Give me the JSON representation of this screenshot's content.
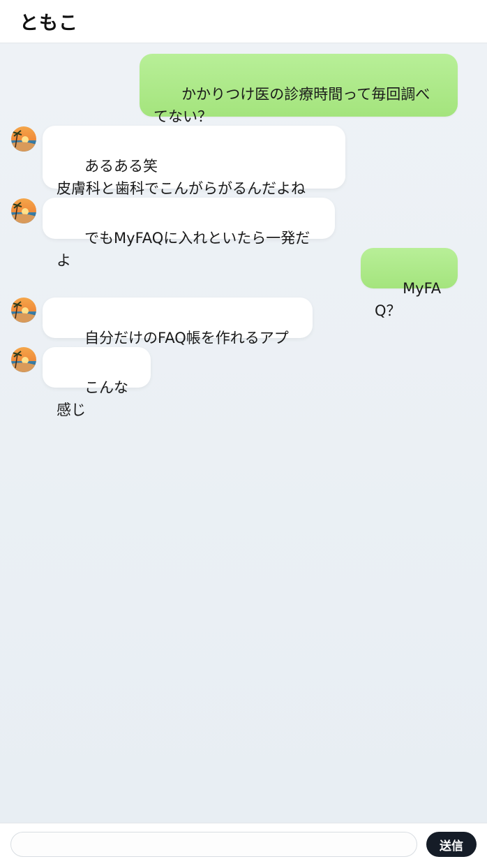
{
  "header": {
    "title": "ともこ"
  },
  "messages": [
    {
      "sender": "me",
      "text": "かかりつけ医の診療時間って毎回調べてない？"
    },
    {
      "sender": "them",
      "text": "あるある笑\n皮膚科と歯科でこんがらがるんだよね"
    },
    {
      "sender": "them",
      "text": "でもMyFAQに入れといたら一発だよ"
    },
    {
      "sender": "me",
      "text": "MyFAQ？"
    },
    {
      "sender": "them",
      "text": "自分だけのFAQ帳を作れるアプリ"
    },
    {
      "sender": "them",
      "text": "こんな感じ"
    }
  ],
  "composer": {
    "input_value": "",
    "input_placeholder": "",
    "send_label": "送信"
  },
  "colors": {
    "my_bubble": "#a8e888",
    "their_bubble": "#ffffff",
    "chat_background": "#eef2f6",
    "send_button": "#151c27"
  },
  "icons": {
    "avatar": "sunset-beach-avatar"
  }
}
